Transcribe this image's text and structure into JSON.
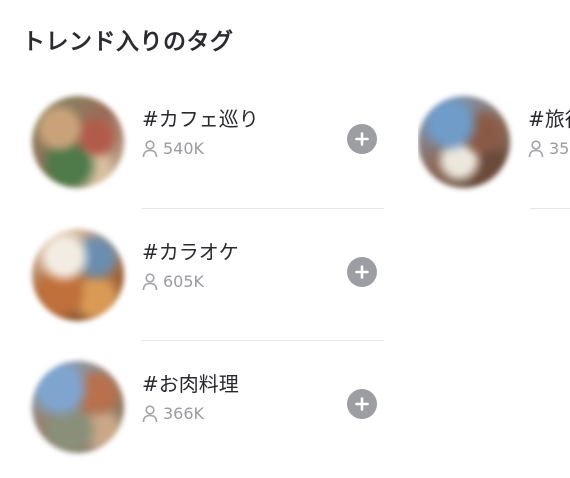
{
  "section": {
    "title": "トレンド入りのタグ"
  },
  "tags": [
    {
      "name": "#カフェ巡り",
      "count": "540K",
      "icon": "plus-icon"
    },
    {
      "name": "#カラオケ",
      "count": "605K",
      "icon": "plus-icon"
    },
    {
      "name": "#お肉料理",
      "count": "366K",
      "icon": "plus-icon"
    },
    {
      "name": "#旅行",
      "count": "35",
      "icon": "plus-icon"
    }
  ],
  "colors": {
    "follow_button": "#9c9ea3",
    "count_text": "#9a9aa1",
    "divider": "#e6e6ea"
  }
}
